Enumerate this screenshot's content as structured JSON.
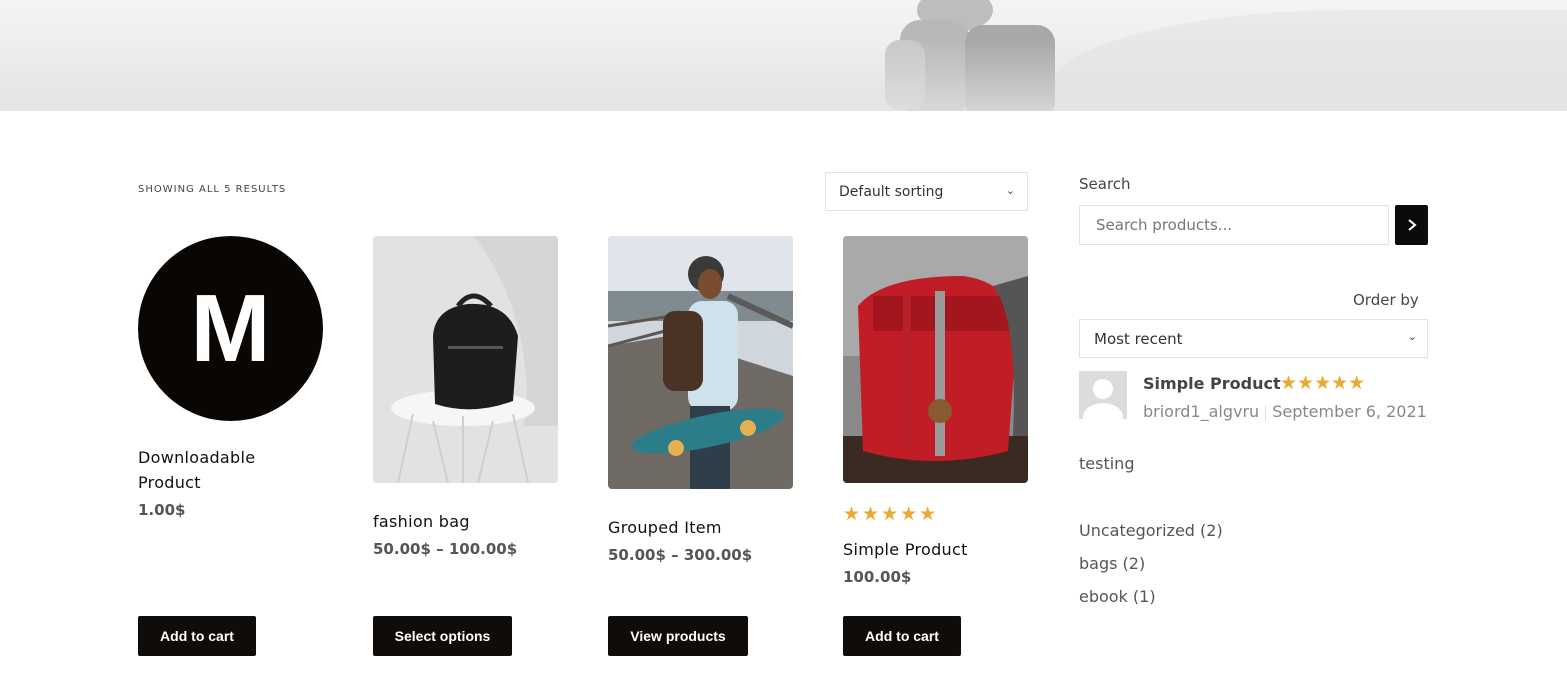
{
  "results_text": "SHOWING ALL 5 RESULTS",
  "sorting": {
    "selected": "Default sorting"
  },
  "products": [
    {
      "title_line1": "Downloadable",
      "title_line2": "Product",
      "price": "1.00$",
      "button": "Add to cart",
      "image": "letter-m-logo",
      "logo_letter": "M"
    },
    {
      "title": "fashion bag",
      "price": "50.00$ – 100.00$",
      "button": "Select options",
      "image": "backpack-on-chair-photo"
    },
    {
      "title": "Grouped Item",
      "price": "50.00$ – 300.00$",
      "button": "View products",
      "image": "woman-with-skateboard-photo"
    },
    {
      "title": "Simple Product",
      "price": "100.00$",
      "button": "Add to cart",
      "image": "red-backpack-photo",
      "rating": 5,
      "stars": "★★★★★"
    }
  ],
  "sidebar": {
    "search_label": "Search",
    "search_placeholder": "Search products...",
    "order_label": "Order by",
    "order_selected": "Most recent",
    "review": {
      "product": "Simple Product",
      "stars": "★★★★★",
      "rating": 5,
      "author": "briord1_algvru",
      "date": "September 6, 2021",
      "text": "testing"
    },
    "categories": [
      "Uncategorized (2)",
      "bags (2)",
      "ebook (1)"
    ]
  },
  "colors": {
    "button_bg": "#0f0c09",
    "star": "#e9a932"
  }
}
